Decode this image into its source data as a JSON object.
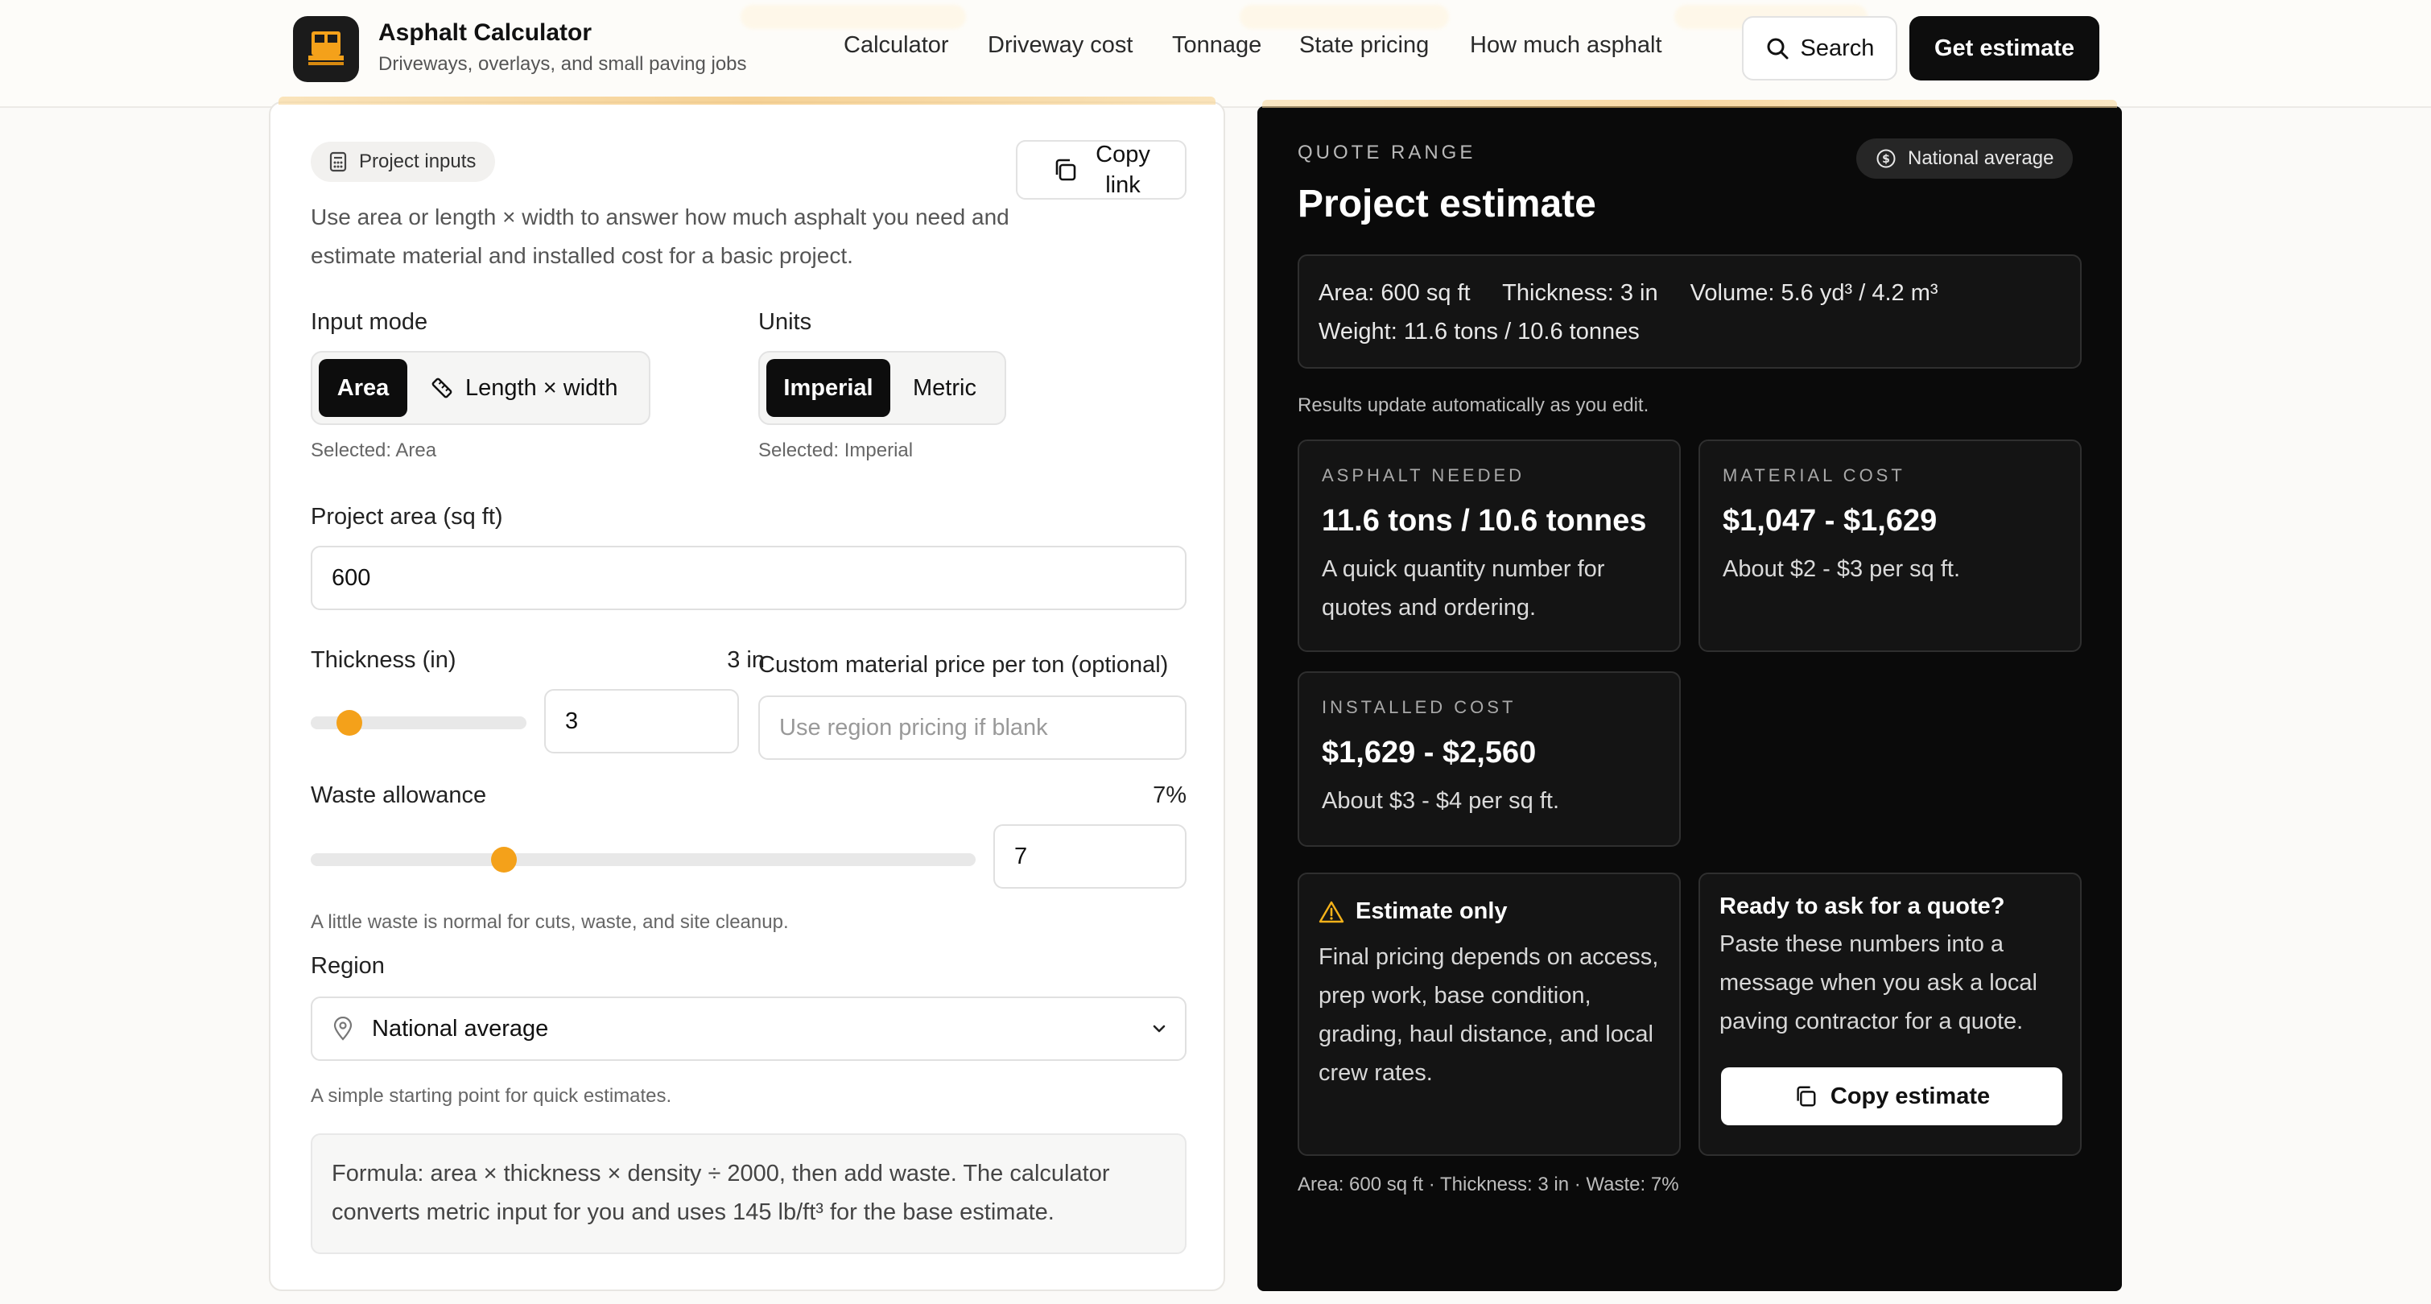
{
  "header": {
    "brand_title": "Asphalt Calculator",
    "brand_subtitle": "Driveways, overlays, and small paving jobs",
    "nav": [
      "Calculator",
      "Driveway cost",
      "Tonnage",
      "State pricing",
      "How much asphalt"
    ],
    "search_label": "Search",
    "cta_label": "Get estimate"
  },
  "inputs": {
    "pill_label": "Project inputs",
    "copy_link_line1": "Copy",
    "copy_link_line2": "link",
    "intro": "Use area or length × width to answer how much asphalt you need and estimate material and installed cost for a basic project.",
    "input_mode": {
      "label": "Input mode",
      "options": [
        "Area",
        "Length × width"
      ],
      "selected_note": "Selected: Area"
    },
    "units": {
      "label": "Units",
      "options": [
        "Imperial",
        "Metric"
      ],
      "selected_note": "Selected: Imperial"
    },
    "area": {
      "label": "Project area (sq ft)",
      "value": "600"
    },
    "thickness": {
      "label": "Thickness (in)",
      "display": "3 in",
      "value": "3",
      "slider_fraction": 0.18
    },
    "custom_price": {
      "label": "Custom material price per ton (optional)",
      "placeholder": "Use region pricing if blank"
    },
    "waste": {
      "label": "Waste allowance",
      "display": "7%",
      "value": "7",
      "slider_fraction": 0.29,
      "hint": "A little waste is normal for cuts, waste, and site cleanup."
    },
    "region": {
      "label": "Region",
      "selected": "National average",
      "hint": "A simple starting point for quick estimates."
    },
    "formula": "Formula: area × thickness × density ÷ 2000, then add waste. The calculator converts metric input for you and uses 145 lb/ft³ for the base estimate."
  },
  "results": {
    "eyebrow": "QUOTE RANGE",
    "region_pill": "National average",
    "title": "Project estimate",
    "summary": {
      "area": "Area: 600 sq ft",
      "thickness": "Thickness: 3 in",
      "volume": "Volume: 5.6 yd³ / 4.2 m³",
      "weight": "Weight: 11.6 tons / 10.6 tonnes"
    },
    "auto_note": "Results update automatically as you edit.",
    "cards": [
      {
        "eyebrow": "ASPHALT NEEDED",
        "value": "11.6 tons / 10.6 tonnes",
        "desc": "A quick quantity number for quotes and ordering."
      },
      {
        "eyebrow": "MATERIAL COST",
        "value": "$1,047 - $1,629",
        "desc": "About $2 - $3 per sq ft."
      },
      {
        "eyebrow": "INSTALLED COST",
        "value": "$1,629 - $2,560",
        "desc": "About $3 - $4 per sq ft."
      }
    ],
    "disclaimer": {
      "title": "Estimate only",
      "body": "Final pricing depends on access, prep work, base condition, grading, haul distance, and local crew rates."
    },
    "quote": {
      "title": "Ready to ask for a quote?",
      "body": "Paste these numbers into a message when you ask a local paving contractor for a quote.",
      "button": "Copy estimate"
    },
    "footer": "Area: 600 sq ft · Thickness: 3 in · Waste: 7%"
  },
  "colors": {
    "accent": "#f4a11a",
    "dark_panel": "#0a0a0a",
    "cta": "#0d0d0d"
  }
}
